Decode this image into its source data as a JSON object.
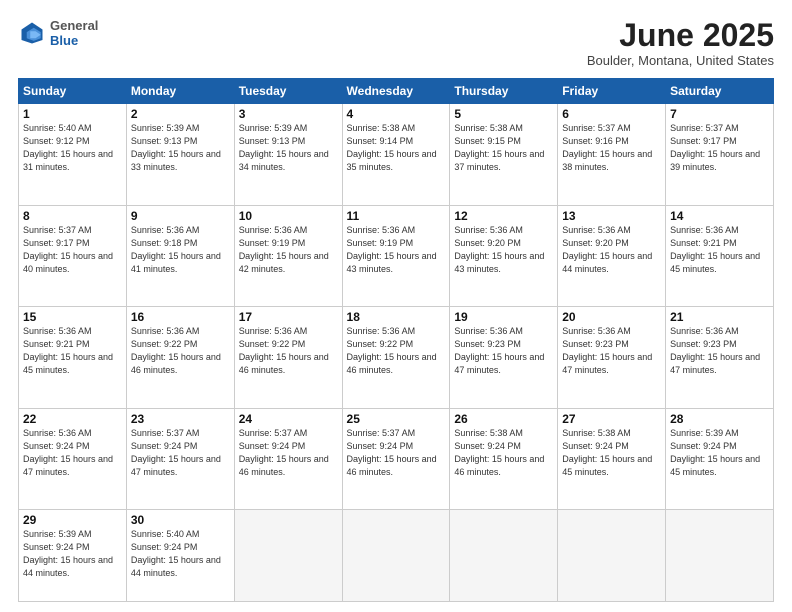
{
  "logo": {
    "general": "General",
    "blue": "Blue"
  },
  "title": "June 2025",
  "location": "Boulder, Montana, United States",
  "weekdays": [
    "Sunday",
    "Monday",
    "Tuesday",
    "Wednesday",
    "Thursday",
    "Friday",
    "Saturday"
  ],
  "weeks": [
    [
      {
        "day": "1",
        "sunrise": "5:40 AM",
        "sunset": "9:12 PM",
        "daylight": "15 hours and 31 minutes."
      },
      {
        "day": "2",
        "sunrise": "5:39 AM",
        "sunset": "9:13 PM",
        "daylight": "15 hours and 33 minutes."
      },
      {
        "day": "3",
        "sunrise": "5:39 AM",
        "sunset": "9:13 PM",
        "daylight": "15 hours and 34 minutes."
      },
      {
        "day": "4",
        "sunrise": "5:38 AM",
        "sunset": "9:14 PM",
        "daylight": "15 hours and 35 minutes."
      },
      {
        "day": "5",
        "sunrise": "5:38 AM",
        "sunset": "9:15 PM",
        "daylight": "15 hours and 37 minutes."
      },
      {
        "day": "6",
        "sunrise": "5:37 AM",
        "sunset": "9:16 PM",
        "daylight": "15 hours and 38 minutes."
      },
      {
        "day": "7",
        "sunrise": "5:37 AM",
        "sunset": "9:17 PM",
        "daylight": "15 hours and 39 minutes."
      }
    ],
    [
      {
        "day": "8",
        "sunrise": "5:37 AM",
        "sunset": "9:17 PM",
        "daylight": "15 hours and 40 minutes."
      },
      {
        "day": "9",
        "sunrise": "5:36 AM",
        "sunset": "9:18 PM",
        "daylight": "15 hours and 41 minutes."
      },
      {
        "day": "10",
        "sunrise": "5:36 AM",
        "sunset": "9:19 PM",
        "daylight": "15 hours and 42 minutes."
      },
      {
        "day": "11",
        "sunrise": "5:36 AM",
        "sunset": "9:19 PM",
        "daylight": "15 hours and 43 minutes."
      },
      {
        "day": "12",
        "sunrise": "5:36 AM",
        "sunset": "9:20 PM",
        "daylight": "15 hours and 43 minutes."
      },
      {
        "day": "13",
        "sunrise": "5:36 AM",
        "sunset": "9:20 PM",
        "daylight": "15 hours and 44 minutes."
      },
      {
        "day": "14",
        "sunrise": "5:36 AM",
        "sunset": "9:21 PM",
        "daylight": "15 hours and 45 minutes."
      }
    ],
    [
      {
        "day": "15",
        "sunrise": "5:36 AM",
        "sunset": "9:21 PM",
        "daylight": "15 hours and 45 minutes."
      },
      {
        "day": "16",
        "sunrise": "5:36 AM",
        "sunset": "9:22 PM",
        "daylight": "15 hours and 46 minutes."
      },
      {
        "day": "17",
        "sunrise": "5:36 AM",
        "sunset": "9:22 PM",
        "daylight": "15 hours and 46 minutes."
      },
      {
        "day": "18",
        "sunrise": "5:36 AM",
        "sunset": "9:22 PM",
        "daylight": "15 hours and 46 minutes."
      },
      {
        "day": "19",
        "sunrise": "5:36 AM",
        "sunset": "9:23 PM",
        "daylight": "15 hours and 47 minutes."
      },
      {
        "day": "20",
        "sunrise": "5:36 AM",
        "sunset": "9:23 PM",
        "daylight": "15 hours and 47 minutes."
      },
      {
        "day": "21",
        "sunrise": "5:36 AM",
        "sunset": "9:23 PM",
        "daylight": "15 hours and 47 minutes."
      }
    ],
    [
      {
        "day": "22",
        "sunrise": "5:36 AM",
        "sunset": "9:24 PM",
        "daylight": "15 hours and 47 minutes."
      },
      {
        "day": "23",
        "sunrise": "5:37 AM",
        "sunset": "9:24 PM",
        "daylight": "15 hours and 47 minutes."
      },
      {
        "day": "24",
        "sunrise": "5:37 AM",
        "sunset": "9:24 PM",
        "daylight": "15 hours and 46 minutes."
      },
      {
        "day": "25",
        "sunrise": "5:37 AM",
        "sunset": "9:24 PM",
        "daylight": "15 hours and 46 minutes."
      },
      {
        "day": "26",
        "sunrise": "5:38 AM",
        "sunset": "9:24 PM",
        "daylight": "15 hours and 46 minutes."
      },
      {
        "day": "27",
        "sunrise": "5:38 AM",
        "sunset": "9:24 PM",
        "daylight": "15 hours and 45 minutes."
      },
      {
        "day": "28",
        "sunrise": "5:39 AM",
        "sunset": "9:24 PM",
        "daylight": "15 hours and 45 minutes."
      }
    ],
    [
      {
        "day": "29",
        "sunrise": "5:39 AM",
        "sunset": "9:24 PM",
        "daylight": "15 hours and 44 minutes."
      },
      {
        "day": "30",
        "sunrise": "5:40 AM",
        "sunset": "9:24 PM",
        "daylight": "15 hours and 44 minutes."
      },
      null,
      null,
      null,
      null,
      null
    ]
  ]
}
